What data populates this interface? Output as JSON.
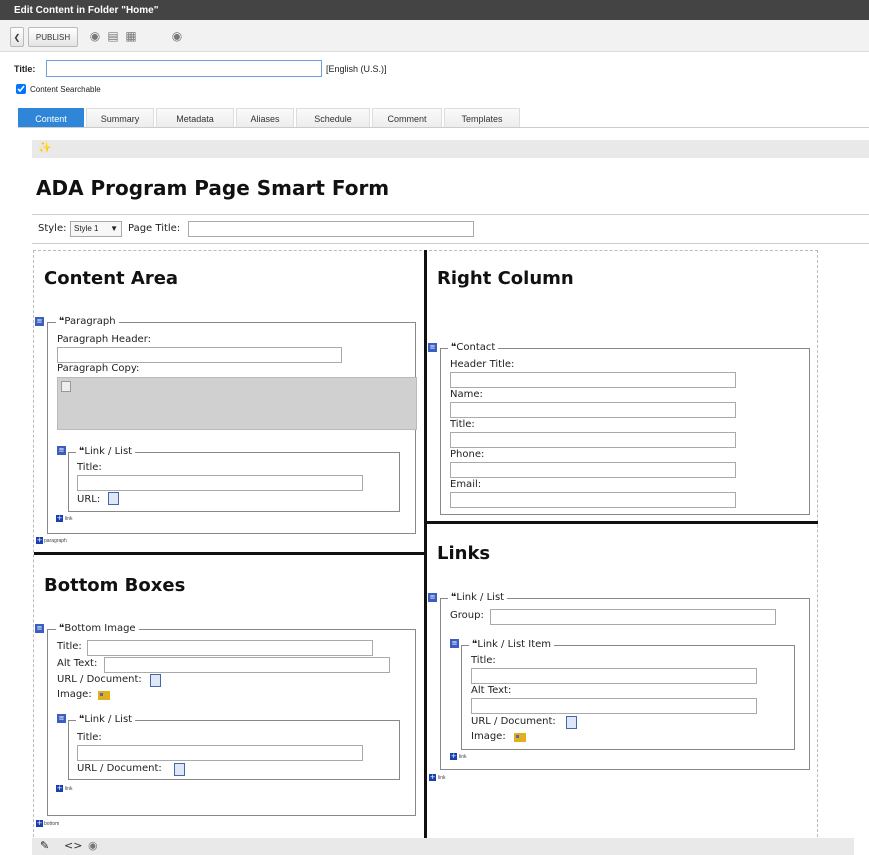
{
  "window": {
    "title": "Edit Content in Folder \"Home\""
  },
  "toolbar": {
    "publish_label": "PUBLISH"
  },
  "meta": {
    "title_label": "Title:",
    "title_value": "",
    "language": "[English (U.S.)]",
    "searchable_label": "Content Searchable",
    "searchable_checked": true
  },
  "tabs": [
    "Content",
    "Summary",
    "Metadata",
    "Aliases",
    "Schedule",
    "Comment",
    "Templates"
  ],
  "active_tab": "Content",
  "form": {
    "title": "ADA Program Page Smart Form",
    "style_label": "Style:",
    "style_value": "Style 1",
    "page_title_label": "Page Title:"
  },
  "content_area": {
    "heading": "Content Area",
    "paragraph": {
      "legend": "Paragraph",
      "header_label": "Paragraph Header:",
      "copy_label": "Paragraph Copy:",
      "link_list": {
        "legend": "Link / List",
        "title_label": "Title:",
        "url_label": "URL:"
      },
      "add_link": "link"
    },
    "add_paragraph": "paragraph"
  },
  "right_column": {
    "heading": "Right Column",
    "contact": {
      "legend": "Contact",
      "fields": [
        "Header Title:",
        "Name:",
        "Title:",
        "Phone:",
        "Email:"
      ]
    }
  },
  "bottom_boxes": {
    "heading": "Bottom Boxes",
    "bottom_image": {
      "legend": "Bottom Image",
      "title_label": "Title:",
      "alt_label": "Alt Text:",
      "url_label": "URL / Document:",
      "image_label": "Image:",
      "link_list": {
        "legend": "Link / List",
        "title_label": "Title:",
        "url_label": "URL / Document:"
      },
      "add_link": "link"
    },
    "add_bottom": "bottom"
  },
  "links": {
    "heading": "Links",
    "link_list": {
      "legend": "Link / List",
      "group_label": "Group:",
      "item": {
        "legend": "Link / List Item",
        "title_label": "Title:",
        "alt_label": "Alt Text:",
        "url_label": "URL / Document:",
        "image_label": "Image:"
      },
      "add_link": "link"
    },
    "add_link": "link"
  },
  "colors": {
    "active_tab": "#2f86d8",
    "titlebar": "#444444"
  }
}
